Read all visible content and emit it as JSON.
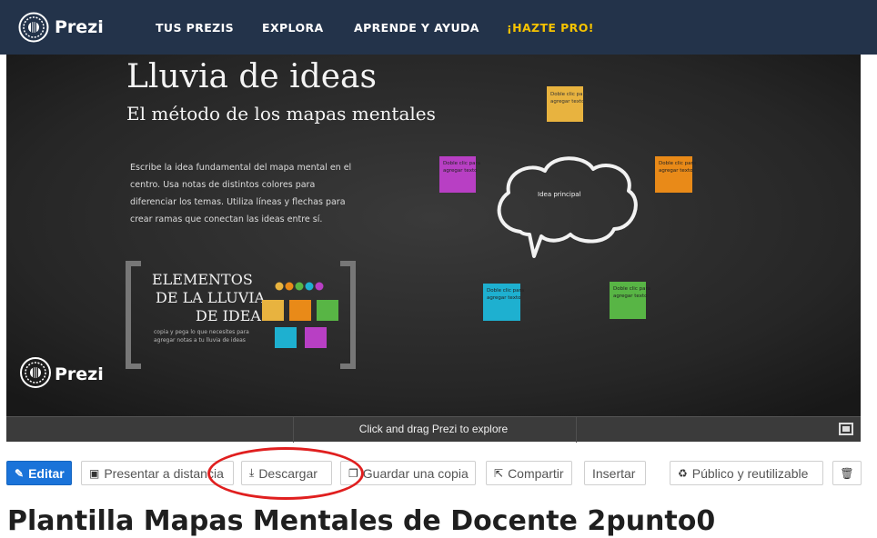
{
  "header": {
    "brand": "Prezi",
    "nav": [
      "TUS PREZIS",
      "EXPLORA",
      "APRENDE Y AYUDA",
      "¡HAZTE PRO!"
    ],
    "pro_color": "#f6c300",
    "bg_color": "#23334a"
  },
  "canvas": {
    "title": "Lluvia de ideas",
    "subtitle": "El método de los mapas mentales",
    "description": [
      "Escribe la idea fundamental del mapa mental en el",
      "centro. Usa notas de distintos colores para",
      "diferenciar los temas. Utiliza líneas y flechas para",
      "crear ramas que conectan las ideas entre sí."
    ],
    "elements_title": [
      "ELEMENTOS",
      "DE LA LLUVIA",
      "DE IDEAS"
    ],
    "elements_caption": [
      "copia y pega lo que necesites para",
      "agregar notas a tu lluvia de ideas"
    ],
    "cloud_label": "Idea principal",
    "note_text": [
      "Doble clic para",
      "agregar texto"
    ],
    "watermark": "Prezi",
    "note_colors": {
      "yellow": "#e8b33f",
      "purple": "#b83fc4",
      "orange": "#e98a18",
      "cyan": "#1eb0d0",
      "green": "#58b545"
    }
  },
  "viewer": {
    "hint": "Click and drag Prezi to explore",
    "fullscreen_icon": "fullscreen-icon"
  },
  "actions": {
    "edit": "Editar",
    "present": "Presentar a distancia",
    "download": "Descargar",
    "save_copy": "Guardar una copia",
    "share": "Compartir",
    "insert": "Insertar",
    "public": "Público y reutilizable",
    "delete_icon": "trash-icon",
    "primary_color": "#1a73d9",
    "highlight_color": "#e01f1f"
  },
  "page": {
    "title": "Plantilla Mapas Mentales de Docente 2punto0"
  }
}
